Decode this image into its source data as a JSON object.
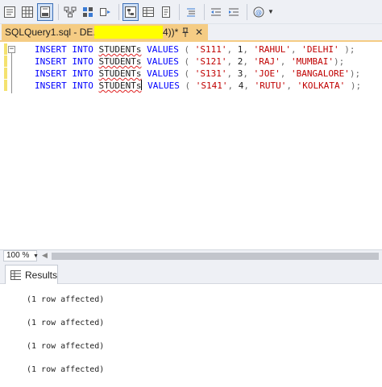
{
  "toolbar": {
    "buttons": [
      {
        "icon": "results-to-text-icon"
      },
      {
        "icon": "results-to-grid-icon"
      },
      {
        "icon": "results-to-file-icon"
      },
      {
        "icon": "display-estimated-plan-icon"
      },
      {
        "icon": "query-options-icon"
      },
      {
        "icon": "intellisense-icon"
      },
      {
        "icon": "include-actual-plan-icon"
      },
      {
        "icon": "include-statistics-icon"
      },
      {
        "icon": "include-client-stats-icon"
      },
      {
        "icon": "comment-lines-icon"
      },
      {
        "icon": "decrease-indent-icon"
      },
      {
        "icon": "increase-indent-icon"
      },
      {
        "icon": "specify-values-icon"
      }
    ]
  },
  "tab": {
    "title": "SQLQuery1.sql - DE...",
    "title_suffix": "4))*",
    "pin_icon": "pin-icon",
    "close_glyph": "✕"
  },
  "editor": {
    "collapse_glyph": "−",
    "lines": [
      {
        "kw1": "INSERT",
        "kw2": "INTO",
        "table": "STUDENTs",
        "kw3": "VALUES",
        "open": "(",
        "id": "'S111'",
        "age": "1",
        "name": "'RAHUL'",
        "city": "'DELHI'",
        "close": ");"
      },
      {
        "kw1": "INSERT",
        "kw2": "INTO",
        "table": "STUDENTs",
        "kw3": "VALUES",
        "open": "(",
        "id": "'S121'",
        "age": "2",
        "name": "'RAJ'",
        "city": "'MUMBAI'",
        "close": ");"
      },
      {
        "kw1": "INSERT",
        "kw2": "INTO",
        "table": "STUDENTs",
        "kw3": "VALUES",
        "open": "(",
        "id": "'S131'",
        "age": "3",
        "name": "'JOE'",
        "city": "'BANGALORE'",
        "close": ");"
      },
      {
        "kw1": "INSERT",
        "kw2": "INTO",
        "table": "STUDENTs",
        "kw3": "VALUES",
        "open": "(",
        "id": "'S141'",
        "age": "4",
        "name": "'RUTU'",
        "city": "'KOLKATA'",
        "close": ");"
      }
    ]
  },
  "zoom": {
    "value": "100 %"
  },
  "results": {
    "tab_label": "Results",
    "messages": [
      "(1 row affected)",
      "(1 row affected)",
      "(1 row affected)",
      "(1 row affected)"
    ]
  },
  "colors": {
    "keyword": "#0000ff",
    "string": "#c00000",
    "tab_active": "#f5cc84",
    "change_bar": "#f4e26f"
  }
}
